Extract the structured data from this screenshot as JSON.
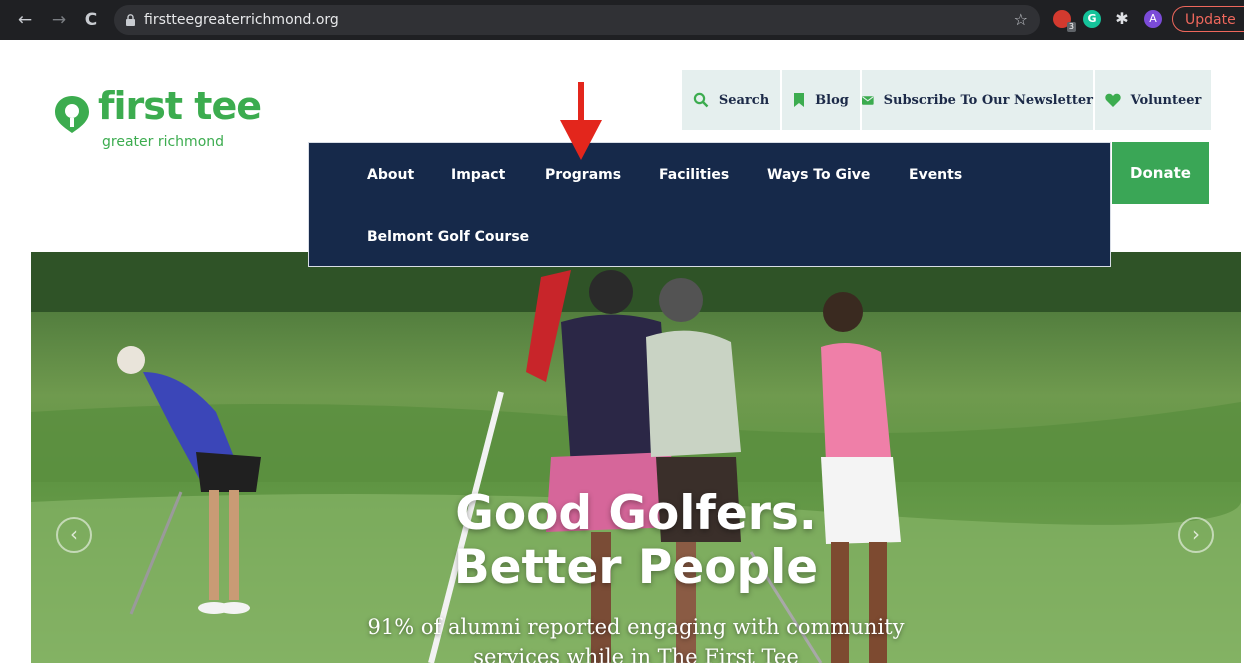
{
  "browser": {
    "url": "firstteegreaterrichmond.org",
    "back_icon": "←",
    "forward_icon": "→",
    "reload_icon": "C",
    "star_icon": "☆",
    "extension_badge": "3",
    "extension_g": "G",
    "puzzle_icon": "✱",
    "profile_initial": "A",
    "update_label": "Update"
  },
  "site": {
    "logo_word": "first tee",
    "logo_sub": "greater richmond",
    "utility": {
      "search": "Search",
      "blog": "Blog",
      "newsletter": "Subscribe To Our Newsletter",
      "volunteer": "Volunteer"
    },
    "donate": "Donate",
    "nav": {
      "about": "About",
      "impact": "Impact",
      "programs": "Programs",
      "facilities": "Facilities",
      "ways_to_give": "Ways To Give",
      "events": "Events",
      "belmont": "Belmont Golf Course"
    },
    "hero": {
      "headline_1": "Good Golfers.",
      "headline_2": "Better People",
      "subline_1": "91% of alumni reported engaging with community",
      "subline_2": "services while in The First Tee",
      "prev_icon": "‹",
      "next_icon": "›"
    }
  },
  "colors": {
    "brand_green": "#3cac4f",
    "nav_navy": "#16294a",
    "annotation_red": "#e3261c"
  }
}
